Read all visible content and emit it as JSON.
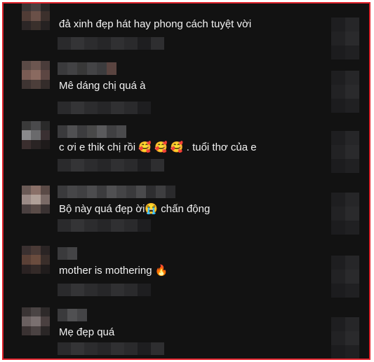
{
  "comments": [
    {
      "text": "đả xinh đẹp hát hay phong cách tuyệt vời"
    },
    {
      "text": "Mê dáng chị quá à"
    },
    {
      "text": "c ơi e thik chị rồi 🥰 🥰 🥰 . tuổi thơ của e"
    },
    {
      "text": "Bộ này quá đẹp ời😭 chấn động"
    },
    {
      "text": "mother is mothering 🔥"
    },
    {
      "text": "Mẹ đẹp quá"
    }
  ],
  "colors": {
    "background": "#121212",
    "text": "#f2f2f2",
    "border_highlight": "#e0242c"
  },
  "icons": [
    "blurred-avatar-icon",
    "heart-like-icon"
  ]
}
